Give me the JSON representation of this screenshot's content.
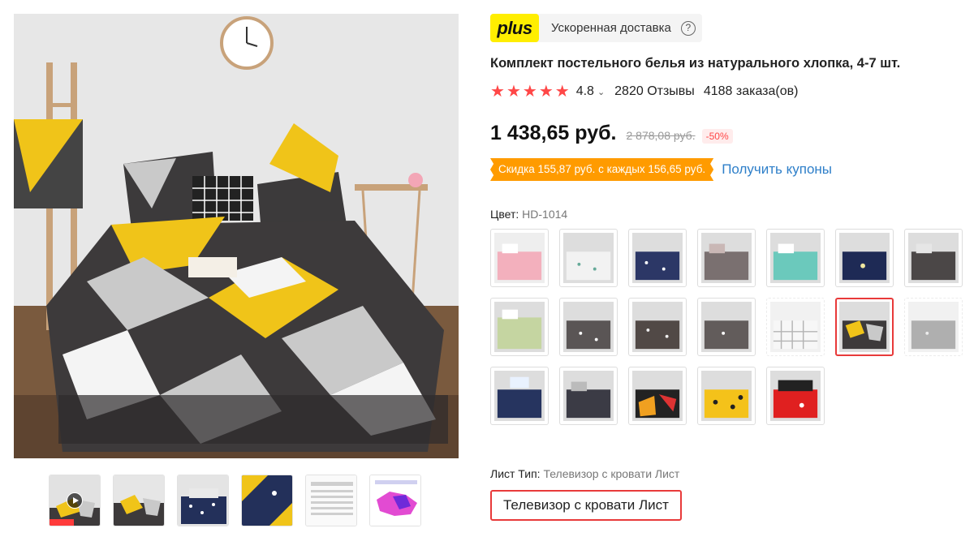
{
  "plus": {
    "logo": "plus",
    "delivery_text": "Ускоренная доставка",
    "help": "?"
  },
  "product": {
    "title": "Комплект постельного белья из натурального хлопка, 4-7 шт.",
    "rating": "4.8",
    "rating_chevron": "⌄",
    "reviews": "2820 Отзывы",
    "orders": "4188 заказа(ов)",
    "stars": 5
  },
  "price": {
    "current": "1 438,65 руб.",
    "old": "2 878,08 руб.",
    "discount": "-50%"
  },
  "coupon": {
    "text": "Скидка 155,87 руб. с каждых 156,65 руб.",
    "link": "Получить купоны"
  },
  "color": {
    "label": "Цвет:",
    "value": "HD-1014"
  },
  "sheet": {
    "label": "Лист Тип:",
    "value": "Телевизор с кровати Лист",
    "option": "Телевизор с кровати Лист"
  },
  "colors": {
    "accent": "#ff4747",
    "coupon": "#ff9b00",
    "link": "#2e7fc9",
    "plus_yellow": "#ffee00"
  }
}
